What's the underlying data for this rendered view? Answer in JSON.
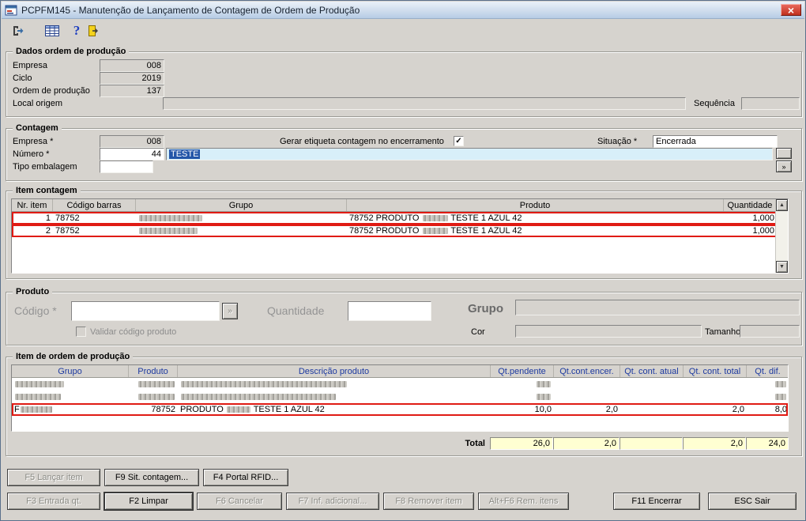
{
  "window": {
    "title": "PCPFM145 - Manutenção de Lançamento de Contagem de Ordem de Produção",
    "close_glyph": "×"
  },
  "toolbar": {
    "icons": [
      "exit-icon",
      "grid-icon",
      "help-icon",
      "logout-icon"
    ],
    "help_glyph": "?"
  },
  "scrollbar": {
    "up": "▲",
    "down": "▼"
  },
  "colors": {
    "red_annotation": "#e01b14",
    "total_bg": "#ffffd2",
    "selection_blue": "#2456a8",
    "close_button_red": "#c0321f",
    "header_text_blue": "#1d3aa0"
  },
  "dados_op": {
    "title": "Dados ordem de produção",
    "empresa_label": "Empresa",
    "empresa_value": "008",
    "ciclo_label": "Ciclo",
    "ciclo_value": "2019",
    "ordem_label": "Ordem de produção",
    "ordem_value": "137",
    "local_label": "Local origem",
    "local_value": "",
    "sequencia_label": "Sequência",
    "sequencia_value": ""
  },
  "contagem": {
    "title": "Contagem",
    "empresa_label": "Empresa *",
    "empresa_value": "008",
    "numero_label": "Número *",
    "numero_value": "44",
    "descricao_value": "TESTE",
    "tipo_label": "Tipo embalagem",
    "tipo_value": "",
    "etiqueta_label": "Gerar etiqueta contagem no encerramento",
    "etiqueta_checked": true,
    "situacao_label": "Situação *",
    "situacao_value": "Encerrada",
    "expand_label": "»"
  },
  "item_contagem": {
    "title": "Item contagem",
    "columns": [
      "Nr. item",
      "Código barras",
      "Grupo",
      "Produto",
      "Quantidade"
    ],
    "rows": [
      {
        "highlight": true,
        "cells": [
          [
            {
              "text": "1"
            }
          ],
          [
            {
              "text": "78752"
            }
          ],
          [
            {
              "redact": 80
            }
          ],
          [
            {
              "text": "78752 PRODUTO "
            },
            {
              "redact": 32
            },
            {
              "text": " TESTE 1 AZUL 42"
            }
          ],
          [
            {
              "text": "1,000"
            }
          ]
        ]
      },
      {
        "highlight": true,
        "cells": [
          [
            {
              "text": "2"
            }
          ],
          [
            {
              "text": "78752"
            }
          ],
          [
            {
              "redact": 74
            }
          ],
          [
            {
              "text": "78752 PRODUTO "
            },
            {
              "redact": 32
            },
            {
              "text": " TESTE 1 AZUL 42"
            }
          ],
          [
            {
              "text": "1,000"
            }
          ]
        ]
      }
    ]
  },
  "produto": {
    "title": "Produto",
    "codigo_label": "Código *",
    "codigo_value": "",
    "validar_label": "Validar código produto",
    "validar_checked": false,
    "quantidade_label": "Quantidade",
    "quantidade_value": "",
    "grupo_label": "Grupo",
    "grupo_value": "",
    "cor_label": "Cor",
    "cor_value": "",
    "tamanho_label": "Tamanho",
    "tamanho_value": "",
    "expand_label": "»"
  },
  "item_op": {
    "title": "Item de ordem de produção",
    "columns": [
      "Grupo",
      "Produto",
      "Descrição produto",
      "Qt.pendente",
      "Qt.cont.encer.",
      "Qt. cont. atual",
      "Qt. cont. total",
      "Qt. dif."
    ],
    "rows": [
      {
        "highlight": false,
        "cells": [
          [
            {
              "redact": 62
            }
          ],
          [
            {
              "redact": 46
            }
          ],
          [
            {
              "redact": 210
            }
          ],
          [
            {
              "redact": 18
            }
          ],
          [],
          [],
          [],
          [
            {
              "redact": 14
            }
          ]
        ]
      },
      {
        "highlight": false,
        "cells": [
          [
            {
              "redact": 58
            }
          ],
          [
            {
              "redact": 46
            }
          ],
          [
            {
              "redact": 196
            }
          ],
          [
            {
              "redact": 18
            }
          ],
          [],
          [],
          [],
          [
            {
              "redact": 14
            }
          ]
        ]
      },
      {
        "highlight": true,
        "cells": [
          [
            {
              "text": "F"
            },
            {
              "redact": 40
            }
          ],
          [
            {
              "text": "78752"
            }
          ],
          [
            {
              "text": "PRODUTO "
            },
            {
              "redact": 30
            },
            {
              "text": " TESTE 1 AZUL 42"
            }
          ],
          [
            {
              "text": "10,0"
            }
          ],
          [
            {
              "text": "2,0"
            }
          ],
          [],
          [
            {
              "text": "2,0"
            }
          ],
          [
            {
              "text": "8,0"
            }
          ]
        ]
      }
    ],
    "total_label": "Total",
    "total_values": [
      "26,0",
      "2,0",
      "",
      "2,0",
      "24,0"
    ]
  },
  "buttons": {
    "row1": [
      {
        "label": "F5 Lançar item",
        "enabled": false
      },
      {
        "label": "F9 Sit. contagem...",
        "enabled": true
      },
      {
        "label": "F4 Portal RFID...",
        "enabled": true
      }
    ],
    "row2": [
      {
        "label": "F3 Entrada qt.",
        "enabled": false
      },
      {
        "label": "F2 Limpar",
        "enabled": true,
        "default": true
      },
      {
        "label": "F6 Cancelar",
        "enabled": false
      },
      {
        "label": "F7 Inf. adicional...",
        "enabled": false
      },
      {
        "label": "F8 Remover item",
        "enabled": false
      },
      {
        "label": "Alt+F6 Rem. itens",
        "enabled": false
      }
    ],
    "row2_right": [
      {
        "label": "F11 Encerrar",
        "enabled": true
      },
      {
        "label": "ESC Sair",
        "enabled": true
      }
    ]
  }
}
